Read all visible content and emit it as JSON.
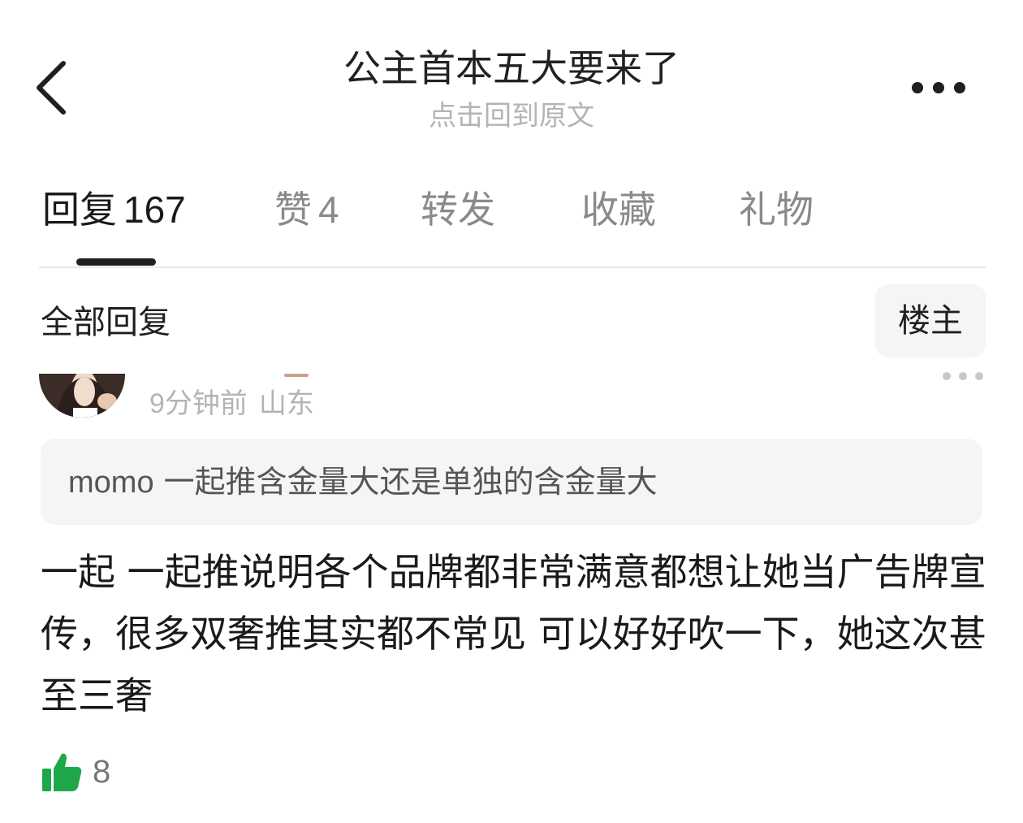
{
  "header": {
    "back_icon": "chevron-left-icon",
    "title": "公主首本五大要来了",
    "subtitle": "点击回到原文",
    "more_icon": "more-horizontal-icon"
  },
  "tabs": [
    {
      "label": "回复",
      "count": "167",
      "active": true
    },
    {
      "label": "赞",
      "count": "4",
      "active": false
    },
    {
      "label": "转发",
      "count": "",
      "active": false
    },
    {
      "label": "收藏",
      "count": "",
      "active": false
    },
    {
      "label": "礼物",
      "count": "",
      "active": false
    }
  ],
  "section": {
    "title": "全部回复",
    "op_filter_label": "楼主"
  },
  "reply": {
    "time": "9分钟前",
    "location": "山东",
    "quote_name": "momo",
    "quote_text": "一起推含金量大还是单独的含金量大",
    "body": "一起 一起推说明各个品牌都非常满意都想让她当广告牌宣传，很多双奢推其实都不常见 可以好好吹一下，她这次甚至三奢",
    "likes": "8",
    "like_icon": "thumbs-up-icon",
    "more_icon": "more-horizontal-icon"
  },
  "colors": {
    "like_green": "#1ea84a",
    "muted_text": "#b4b4b4",
    "quote_bg": "#f5f5f5"
  }
}
